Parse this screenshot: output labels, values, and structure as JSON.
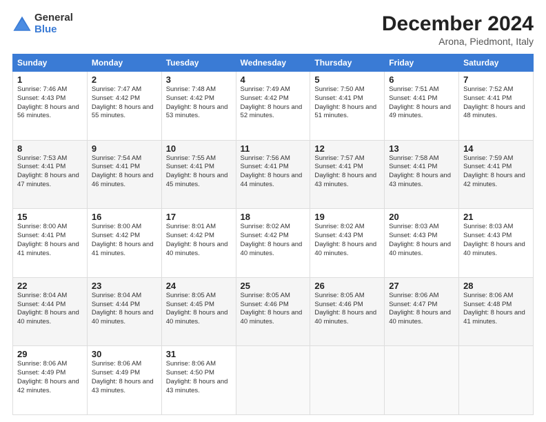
{
  "header": {
    "logo_general": "General",
    "logo_blue": "Blue",
    "title": "December 2024",
    "subtitle": "Arona, Piedmont, Italy"
  },
  "days_of_week": [
    "Sunday",
    "Monday",
    "Tuesday",
    "Wednesday",
    "Thursday",
    "Friday",
    "Saturday"
  ],
  "weeks": [
    [
      {
        "day": "1",
        "sunrise": "7:46 AM",
        "sunset": "4:43 PM",
        "daylight": "8 hours and 56 minutes."
      },
      {
        "day": "2",
        "sunrise": "7:47 AM",
        "sunset": "4:42 PM",
        "daylight": "8 hours and 55 minutes."
      },
      {
        "day": "3",
        "sunrise": "7:48 AM",
        "sunset": "4:42 PM",
        "daylight": "8 hours and 53 minutes."
      },
      {
        "day": "4",
        "sunrise": "7:49 AM",
        "sunset": "4:42 PM",
        "daylight": "8 hours and 52 minutes."
      },
      {
        "day": "5",
        "sunrise": "7:50 AM",
        "sunset": "4:41 PM",
        "daylight": "8 hours and 51 minutes."
      },
      {
        "day": "6",
        "sunrise": "7:51 AM",
        "sunset": "4:41 PM",
        "daylight": "8 hours and 49 minutes."
      },
      {
        "day": "7",
        "sunrise": "7:52 AM",
        "sunset": "4:41 PM",
        "daylight": "8 hours and 48 minutes."
      }
    ],
    [
      {
        "day": "8",
        "sunrise": "7:53 AM",
        "sunset": "4:41 PM",
        "daylight": "8 hours and 47 minutes."
      },
      {
        "day": "9",
        "sunrise": "7:54 AM",
        "sunset": "4:41 PM",
        "daylight": "8 hours and 46 minutes."
      },
      {
        "day": "10",
        "sunrise": "7:55 AM",
        "sunset": "4:41 PM",
        "daylight": "8 hours and 45 minutes."
      },
      {
        "day": "11",
        "sunrise": "7:56 AM",
        "sunset": "4:41 PM",
        "daylight": "8 hours and 44 minutes."
      },
      {
        "day": "12",
        "sunrise": "7:57 AM",
        "sunset": "4:41 PM",
        "daylight": "8 hours and 43 minutes."
      },
      {
        "day": "13",
        "sunrise": "7:58 AM",
        "sunset": "4:41 PM",
        "daylight": "8 hours and 43 minutes."
      },
      {
        "day": "14",
        "sunrise": "7:59 AM",
        "sunset": "4:41 PM",
        "daylight": "8 hours and 42 minutes."
      }
    ],
    [
      {
        "day": "15",
        "sunrise": "8:00 AM",
        "sunset": "4:41 PM",
        "daylight": "8 hours and 41 minutes."
      },
      {
        "day": "16",
        "sunrise": "8:00 AM",
        "sunset": "4:42 PM",
        "daylight": "8 hours and 41 minutes."
      },
      {
        "day": "17",
        "sunrise": "8:01 AM",
        "sunset": "4:42 PM",
        "daylight": "8 hours and 40 minutes."
      },
      {
        "day": "18",
        "sunrise": "8:02 AM",
        "sunset": "4:42 PM",
        "daylight": "8 hours and 40 minutes."
      },
      {
        "day": "19",
        "sunrise": "8:02 AM",
        "sunset": "4:43 PM",
        "daylight": "8 hours and 40 minutes."
      },
      {
        "day": "20",
        "sunrise": "8:03 AM",
        "sunset": "4:43 PM",
        "daylight": "8 hours and 40 minutes."
      },
      {
        "day": "21",
        "sunrise": "8:03 AM",
        "sunset": "4:43 PM",
        "daylight": "8 hours and 40 minutes."
      }
    ],
    [
      {
        "day": "22",
        "sunrise": "8:04 AM",
        "sunset": "4:44 PM",
        "daylight": "8 hours and 40 minutes."
      },
      {
        "day": "23",
        "sunrise": "8:04 AM",
        "sunset": "4:44 PM",
        "daylight": "8 hours and 40 minutes."
      },
      {
        "day": "24",
        "sunrise": "8:05 AM",
        "sunset": "4:45 PM",
        "daylight": "8 hours and 40 minutes."
      },
      {
        "day": "25",
        "sunrise": "8:05 AM",
        "sunset": "4:46 PM",
        "daylight": "8 hours and 40 minutes."
      },
      {
        "day": "26",
        "sunrise": "8:05 AM",
        "sunset": "4:46 PM",
        "daylight": "8 hours and 40 minutes."
      },
      {
        "day": "27",
        "sunrise": "8:06 AM",
        "sunset": "4:47 PM",
        "daylight": "8 hours and 40 minutes."
      },
      {
        "day": "28",
        "sunrise": "8:06 AM",
        "sunset": "4:48 PM",
        "daylight": "8 hours and 41 minutes."
      }
    ],
    [
      {
        "day": "29",
        "sunrise": "8:06 AM",
        "sunset": "4:49 PM",
        "daylight": "8 hours and 42 minutes."
      },
      {
        "day": "30",
        "sunrise": "8:06 AM",
        "sunset": "4:49 PM",
        "daylight": "8 hours and 43 minutes."
      },
      {
        "day": "31",
        "sunrise": "8:06 AM",
        "sunset": "4:50 PM",
        "daylight": "8 hours and 43 minutes."
      },
      null,
      null,
      null,
      null
    ]
  ]
}
